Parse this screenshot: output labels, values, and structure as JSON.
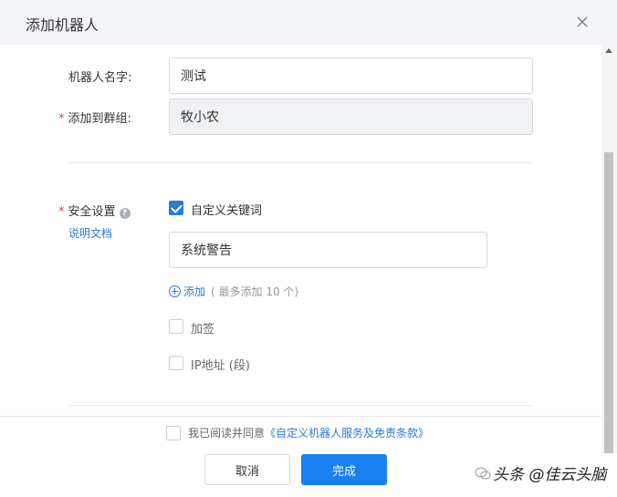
{
  "dialog": {
    "title": "添加机器人"
  },
  "form": {
    "name_label": "机器人名字:",
    "name_value": "测试",
    "group_required_mark": "*",
    "group_label": "添加到群组:",
    "group_value": "牧小农",
    "security_required_mark": "*",
    "security_label": "安全设置",
    "help_icon_glyph": "?",
    "doc_link": "说明文档",
    "custom_keyword": {
      "label": "自定义关键词",
      "checked": true,
      "keyword_value": "系统警告",
      "add_label": "添加",
      "add_note": "( 最多添加 10 个)"
    },
    "sign": {
      "label": "加签",
      "checked": false
    },
    "ip": {
      "label": "IP地址 (段)",
      "checked": false
    }
  },
  "footer": {
    "agree_text": "我已阅读并同意",
    "agree_link": "《自定义机器人服务及免责条款》",
    "cancel_label": "取消",
    "confirm_label": "完成"
  },
  "watermark": {
    "text": "头条 @佳云头脑"
  },
  "colors": {
    "accent": "#2a7ad7",
    "primary_button": "#1a7ff0",
    "required": "#e2403c",
    "header_bg": "#f2f4f7",
    "disabled_bg": "#eff1f3"
  }
}
